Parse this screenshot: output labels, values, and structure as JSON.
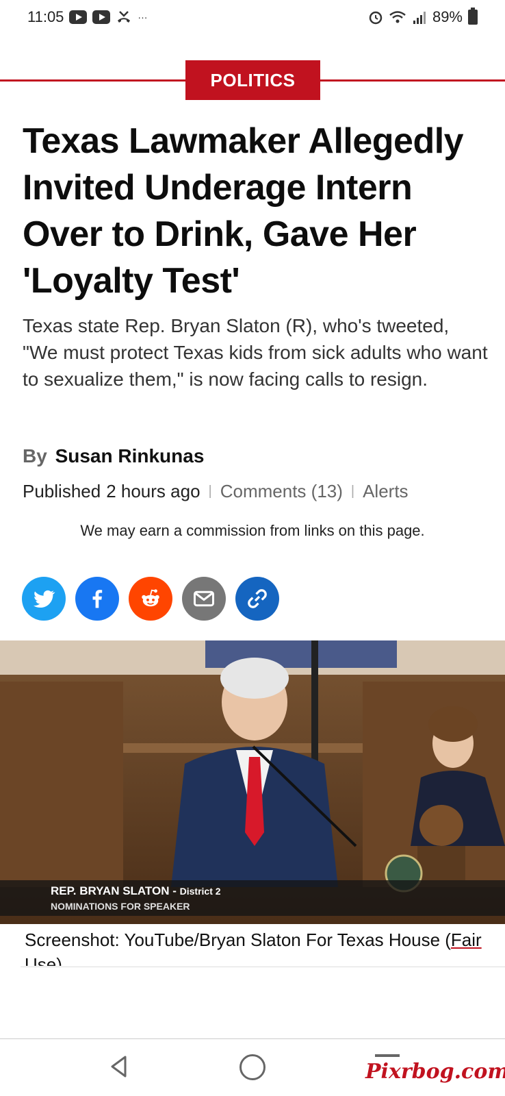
{
  "status_bar": {
    "time": "11:05",
    "more": "···",
    "battery": "89%"
  },
  "section": {
    "label": "POLITICS"
  },
  "article": {
    "headline": "Texas Lawmaker Allegedly Invited Underage Intern Over to Drink, Gave Her 'Loyalty Test'",
    "dek": "Texas state Rep. Bryan Slaton (R), who's tweeted, \"We must protect Texas kids from sick adults who want to sexualize them,\" is now facing calls to resign.",
    "by_label": "By",
    "author": "Susan Rinkunas",
    "published_label": "Published",
    "published_time": "2 hours ago",
    "comments_label": "Comments (13)",
    "alerts_label": "Alerts",
    "disclaimer": "We may earn a commission from links on this page."
  },
  "share": {
    "icons": [
      "twitter-icon",
      "facebook-icon",
      "reddit-icon",
      "email-icon",
      "link-icon"
    ],
    "colors": {
      "twitter": "#1da1f2",
      "facebook": "#1877f2",
      "reddit": "#ff4500",
      "email": "#777777",
      "link": "#1565c0"
    }
  },
  "hero": {
    "chyron_name": "REP. BRYAN SLATON - ",
    "chyron_district": "District 2",
    "chyron_sub": "NOMINATIONS FOR SPEAKER",
    "caption_main": "Screenshot: YouTube/Bryan Slaton For Texas House (",
    "caption_link": "Fair Use",
    "caption_end": ")"
  },
  "watermark": "Pixrbog.com",
  "colors": {
    "accent": "#c1121f"
  }
}
